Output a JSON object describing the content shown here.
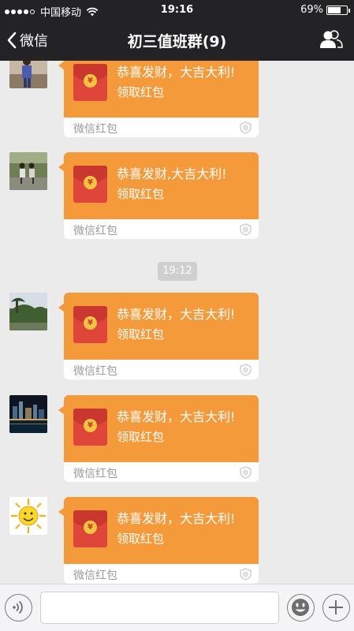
{
  "status_bar": {
    "carrier": "中国移动",
    "time": "19:16",
    "battery": "69%",
    "battery_level": 0.69
  },
  "nav": {
    "back_label": "微信",
    "title": "初三值班群(9)"
  },
  "time_divider": "19:12",
  "messages": [
    {
      "greeting": "恭喜发财，大吉大利!",
      "action": "领取红包",
      "brand": "微信红包"
    },
    {
      "greeting": "恭喜发财,大吉大利!",
      "action": "领取红包",
      "brand": "微信红包"
    },
    {
      "greeting": "恭喜发财，大吉大利!",
      "action": "领取红包",
      "brand": "微信红包"
    },
    {
      "greeting": "恭喜发财，大吉大利!",
      "action": "领取红包",
      "brand": "微信红包"
    },
    {
      "greeting": "恭喜发财，大吉大利!",
      "action": "领取红包",
      "brand": "微信红包"
    }
  ],
  "icons": {
    "back": "chevron-left-icon",
    "members": "group-members-icon",
    "voice": "voice-input-icon",
    "emoji": "emoji-icon",
    "plus": "plus-icon",
    "shield": "shield-icon"
  },
  "colors": {
    "nav_bg": "#232326",
    "chat_bg": "#ebebeb",
    "red_packet": "#f59a3b",
    "envelope": "#e0453a"
  }
}
